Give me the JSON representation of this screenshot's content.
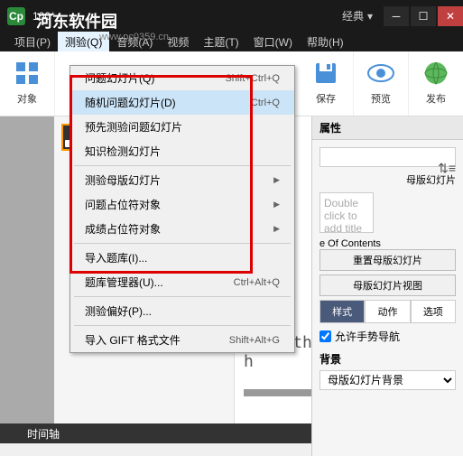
{
  "titlebar": {
    "doc_title": "100*",
    "theme_label": "经典"
  },
  "watermark": "河东软件园",
  "watermark_url": "www.pc0359.cn",
  "menubar": {
    "items": [
      {
        "label": "项目(P)"
      },
      {
        "label": "测验(Q)"
      },
      {
        "label": "音频(A)"
      },
      {
        "label": "视频"
      },
      {
        "label": "主题(T)"
      },
      {
        "label": "窗口(W)"
      },
      {
        "label": "帮助(H)"
      }
    ]
  },
  "toolbar": {
    "objects": "对象",
    "save": "保存",
    "preview": "预览",
    "publish": "发布"
  },
  "dropdown": {
    "items": [
      {
        "label": "问题幻灯片(Q)",
        "shortcut": "Shift+Ctrl+Q",
        "arrow": false
      },
      {
        "label": "随机问题幻灯片(D)",
        "shortcut": "Ctrl+Q",
        "arrow": false,
        "highlight": true
      },
      {
        "label": "预先测验问题幻灯片",
        "shortcut": "",
        "arrow": false
      },
      {
        "label": "知识检测幻灯片",
        "shortcut": "",
        "arrow": false
      },
      {
        "sep": true
      },
      {
        "label": "测验母版幻灯片",
        "shortcut": "",
        "arrow": true
      },
      {
        "label": "问题占位符对象",
        "shortcut": "",
        "arrow": true
      },
      {
        "label": "成绩占位符对象",
        "shortcut": "",
        "arrow": true
      },
      {
        "sep": true
      },
      {
        "label": "导入题库(I)...",
        "shortcut": "",
        "arrow": false
      },
      {
        "label": "题库管理器(U)...",
        "shortcut": "Ctrl+Alt+Q",
        "arrow": false
      },
      {
        "sep": true
      },
      {
        "label": "测验偏好(P)...",
        "shortcut": "",
        "arrow": false
      },
      {
        "sep": true
      },
      {
        "label": "导入 GIFT 格式文件",
        "shortcut": "Shift+Alt+G",
        "arrow": false
      }
    ]
  },
  "canvas": {
    "caption": "Type the caption text h"
  },
  "timeline": {
    "label": "时间轴"
  },
  "properties": {
    "header": "属性",
    "master_slide": "母版幻灯片",
    "thumb_text": "Double click to add title",
    "toc_label": "e Of Contents",
    "btn_reset": "重置母版幻灯片",
    "btn_view": "母版幻灯片视图",
    "tabs": {
      "style": "样式",
      "action": "动作",
      "option": "选项"
    },
    "gesture": "允许手势导航",
    "background": "背景",
    "bg_value": "母版幻灯片背景"
  }
}
